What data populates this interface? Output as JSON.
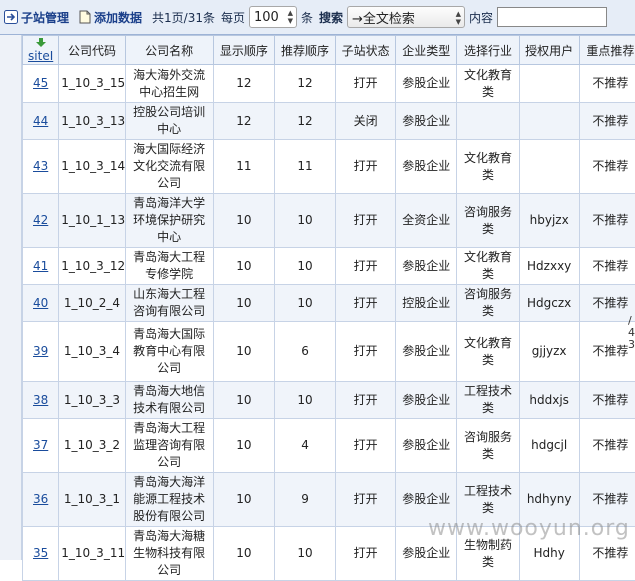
{
  "toolbar": {
    "subsite_manage": "子站管理",
    "add_data": "添加数据",
    "page_info": "共1页/31条",
    "per_page_label": "每页",
    "per_page_value": "100",
    "per_page_unit": "条",
    "search_label": "搜索",
    "search_option": "→全文检索",
    "content_label": "内容"
  },
  "table": {
    "columns": [
      "siteI",
      "公司代码",
      "公司名称",
      "显示顺序",
      "推荐顺序",
      "子站状态",
      "企业类型",
      "选择行业",
      "授权用户",
      "重点推荐"
    ],
    "rows": [
      {
        "id": "45",
        "code": "1_10_3_15",
        "name": "海大海外交流中心招生网",
        "display_order": "12",
        "rec_order": "12",
        "status": "打开",
        "type": "参股企业",
        "industry": "文化教育类",
        "user": "",
        "featured": "不推荐"
      },
      {
        "id": "44",
        "code": "1_10_3_13",
        "name": "控股公司培训中心",
        "display_order": "12",
        "rec_order": "12",
        "status": "关闭",
        "type": "参股企业",
        "industry": "",
        "user": "",
        "featured": "不推荐"
      },
      {
        "id": "43",
        "code": "1_10_3_14",
        "name": "海大国际经济文化交流有限公司",
        "display_order": "11",
        "rec_order": "11",
        "status": "打开",
        "type": "参股企业",
        "industry": "文化教育类",
        "user": "",
        "featured": "不推荐"
      },
      {
        "id": "42",
        "code": "1_10_1_13",
        "name": "青岛海洋大学环境保护研究中心",
        "display_order": "10",
        "rec_order": "10",
        "status": "打开",
        "type": "全资企业",
        "industry": "咨询服务类",
        "user": "hbyjzx",
        "featured": "不推荐"
      },
      {
        "id": "41",
        "code": "1_10_3_12",
        "name": "青岛海大工程专修学院",
        "display_order": "10",
        "rec_order": "10",
        "status": "打开",
        "type": "参股企业",
        "industry": "文化教育类",
        "user": "Hdzxxy",
        "featured": "不推荐"
      },
      {
        "id": "40",
        "code": "1_10_2_4",
        "name": "山东海大工程咨询有限公司",
        "display_order": "10",
        "rec_order": "10",
        "status": "打开",
        "type": "控股企业",
        "industry": "咨询服务类",
        "user": "Hdgczx",
        "featured": "不推荐"
      },
      {
        "id": "39",
        "code": "1_10_3_4",
        "name": "青岛海大国际教育中心有限公司",
        "display_order": "10",
        "rec_order": "6",
        "status": "打开",
        "type": "参股企业",
        "industry": "文化教育类",
        "user": "gjjyzx",
        "featured": "不推荐"
      },
      {
        "id": "38",
        "code": "1_10_3_3",
        "name": "青岛海大地信技术有限公司",
        "display_order": "10",
        "rec_order": "10",
        "status": "打开",
        "type": "参股企业",
        "industry": "工程技术类",
        "user": "hddxjs",
        "featured": "不推荐"
      },
      {
        "id": "37",
        "code": "1_10_3_2",
        "name": "青岛海大工程监理咨询有限公司",
        "display_order": "10",
        "rec_order": "4",
        "status": "打开",
        "type": "参股企业",
        "industry": "咨询服务类",
        "user": "hdgcjl",
        "featured": "不推荐"
      },
      {
        "id": "36",
        "code": "1_10_3_1",
        "name": "青岛海大海洋能源工程技术股份有限公司",
        "display_order": "10",
        "rec_order": "9",
        "status": "打开",
        "type": "参股企业",
        "industry": "工程技术类",
        "user": "hdhyny",
        "featured": "不推荐"
      },
      {
        "id": "35",
        "code": "1_10_3_11",
        "name": "青岛海大海糖生物科技有限公司",
        "display_order": "10",
        "rec_order": "10",
        "status": "打开",
        "type": "参股企业",
        "industry": "生物制药类",
        "user": "Hdhy",
        "featured": "不推荐"
      }
    ]
  },
  "overflow_fragment": [
    "/",
    "4",
    "3"
  ],
  "watermark": "www.wooyun.org",
  "colors": {
    "link": "#1a4c9c",
    "toolbar_bg": "#e6edf7",
    "row_alt": "#f0f4fa"
  }
}
